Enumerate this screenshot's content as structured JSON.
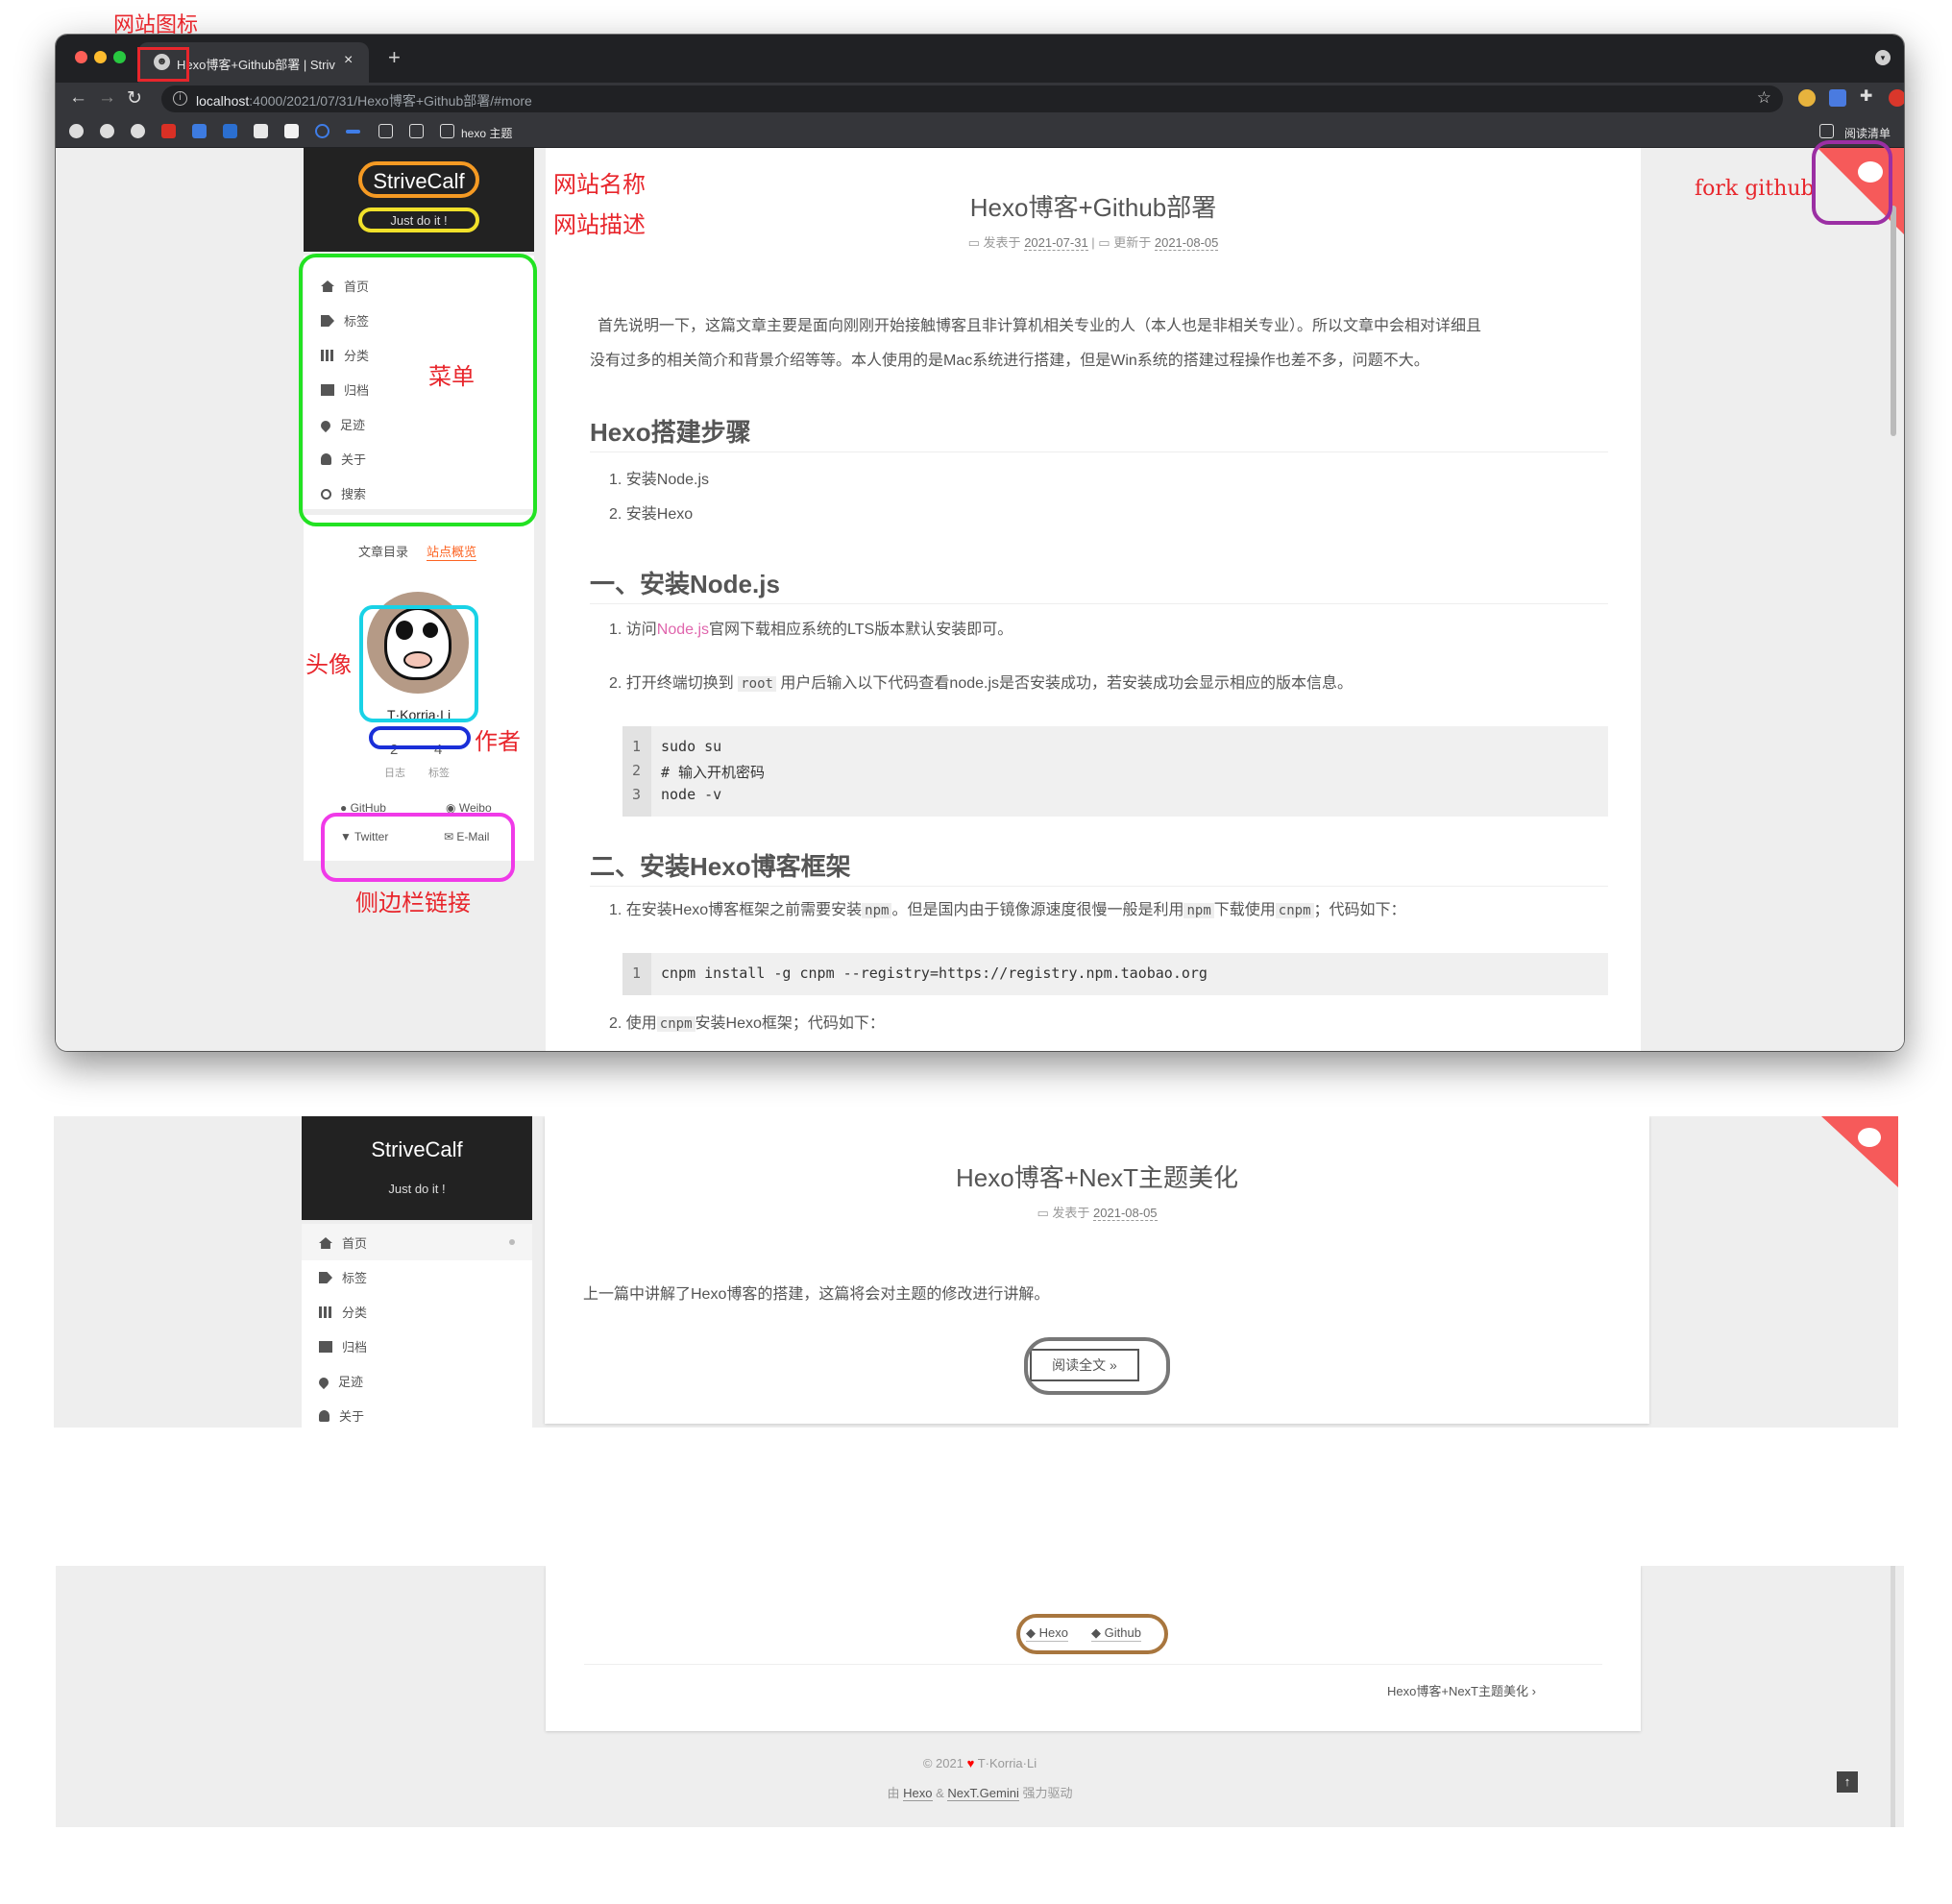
{
  "annotations": {
    "favicon": "网站图标",
    "site_name": "网站名称",
    "site_desc": "网站描述",
    "menu": "菜单",
    "fork": "fork github",
    "avatar": "头像",
    "author": "作者",
    "links": "侧边栏链接"
  },
  "browser": {
    "tab_title": "Hexo博客+Github部署 | StriveC",
    "url_host": "localhost",
    "url_path": ":4000/2021/07/31/Hexo博客+Github部署/#more",
    "bookmark_folder": "hexo 主题",
    "reading_list": "阅读清单",
    "colors": {
      "frame": "#202124",
      "toolbar": "#35363a"
    }
  },
  "site": {
    "title": "StriveCalf",
    "subtitle": "Just do it !",
    "menu": [
      {
        "label": "首页",
        "icon": "home-icon"
      },
      {
        "label": "标签",
        "icon": "tags-icon"
      },
      {
        "label": "分类",
        "icon": "th-icon"
      },
      {
        "label": "归档",
        "icon": "archive-icon"
      },
      {
        "label": "足迹",
        "icon": "map-marker-icon"
      },
      {
        "label": "关于",
        "icon": "user-icon"
      },
      {
        "label": "搜索",
        "icon": "search-icon"
      }
    ],
    "sidebar_tabs": [
      "文章目录",
      "站点概览"
    ],
    "author": "T·Korria·Li",
    "stats": [
      {
        "count": "2",
        "label": "日志"
      },
      {
        "count": "4",
        "label": "标签"
      }
    ],
    "links": [
      "GitHub",
      "Weibo",
      "Twitter",
      "E-Mail"
    ],
    "accent": "#fc6423"
  },
  "post1": {
    "title": "Hexo博客+Github部署",
    "posted_label": "发表于",
    "posted_date": "2021-07-31",
    "updated_label": "更新于",
    "updated_date": "2021-08-05",
    "intro_line1": "首先说明一下，这篇文章主要是面向刚刚开始接触博客且非计算机相关专业的人（本人也是非相关专业）。所以文章中会相对详细且",
    "intro_line2": "没有过多的相关简介和背景介绍等等。本人使用的是Mac系统进行搭建，但是Win系统的搭建过程操作也差不多，问题不大。",
    "h_steps": "Hexo搭建步骤",
    "steps": [
      "1. 安装Node.js",
      "2. 安装Hexo"
    ],
    "h_node": "一、安装Node.js",
    "node1_pre": "1. 访问",
    "node1_link": "Node.js",
    "node1_post": "官网下载相应系统的LTS版本默认安装即可。",
    "node2_pre": "2. 打开终端切换到",
    "node2_code": "root",
    "node2_post": "用户后输入以下代码查看node.js是否安装成功，若安装成功会显示相应的版本信息。",
    "code1": [
      {
        "n": "1",
        "line": "sudo su"
      },
      {
        "n": "2",
        "line": "# 输入开机密码"
      },
      {
        "n": "3",
        "line": "node -v"
      }
    ],
    "h_hexo": "二、安装Hexo博客框架",
    "hexo1_a": "1. 在安装Hexo博客框架之前需要安装",
    "hexo1_c1": "npm",
    "hexo1_b": "。但是国内由于镜像源速度很慢一般是利用",
    "hexo1_c2": "npm",
    "hexo1_c": "下载使用",
    "hexo1_c3": "cnpm",
    "hexo1_d": "；代码如下：",
    "code2_n": "1",
    "code2_line": "cnpm install -g cnpm --registry=https://registry.npm.taobao.org",
    "hexo2_a": "2. 使用",
    "hexo2_code": "cnpm",
    "hexo2_b": "安装Hexo框架；代码如下："
  },
  "post2": {
    "title": "Hexo博客+NexT主题美化",
    "posted_label": "发表于",
    "posted_date": "2021-08-05",
    "excerpt": "上一篇中讲解了Hexo博客的搭建，这篇将会对主题的修改进行讲解。",
    "read_more": "阅读全文 »"
  },
  "footer": {
    "tags": [
      "Hexo",
      "Github"
    ],
    "next_post": "Hexo博客+NexT主题美化",
    "copyright": "© 2021",
    "owner": "T·Korria·Li",
    "powered_a": "由",
    "powered_hexo": "Hexo",
    "powered_amp": "&",
    "powered_next": "NexT.Gemini",
    "powered_b": "强力驱动"
  }
}
